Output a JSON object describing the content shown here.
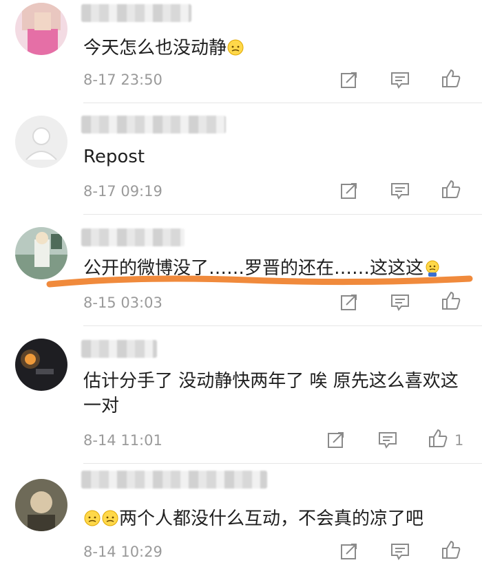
{
  "comments": [
    {
      "text": "今天怎么也没动静",
      "time": "8-17 23:50",
      "likes": ""
    },
    {
      "text": "Repost",
      "time": "8-17 09:19",
      "likes": ""
    },
    {
      "text": "公开的微博没了……罗晋的还在……这这这",
      "time": "8-15 03:03",
      "likes": ""
    },
    {
      "text": "估计分手了 没动静快两年了 唉 原先这么喜欢这一对",
      "time": "8-14 11:01",
      "likes": "1"
    },
    {
      "text": "两个人都没什么互动，不会真的凉了吧",
      "time": "8-14 10:29",
      "likes": ""
    }
  ],
  "highlight_color": "#f08a3c",
  "icons": [
    "repost-icon",
    "comment-icon",
    "like-icon"
  ]
}
